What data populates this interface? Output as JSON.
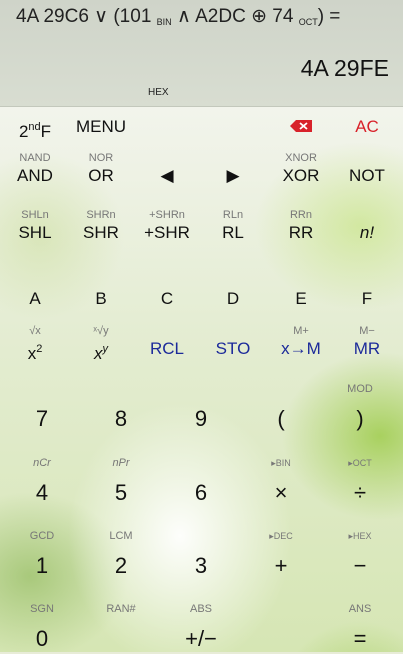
{
  "display": {
    "expr_part1": "4A 29C6 ∨ (101 ",
    "expr_sub1": "BIN",
    "expr_part2": " ∧ A2DC ⊕ 74 ",
    "expr_sub2": "OCT",
    "expr_part3": ") =",
    "result": "4A 29FE",
    "mode": "HEX"
  },
  "colors": {
    "accent_red": "#d8222a",
    "memory_blue": "#1c2a9a"
  },
  "keys": {
    "second": {
      "main": "2",
      "sup": "nd",
      "tail": "F"
    },
    "menu": {
      "main": "MENU"
    },
    "backspace": {
      "icon": "backspace-icon"
    },
    "ac": {
      "main": "AC"
    },
    "and": {
      "sec": "NAND",
      "main": "AND"
    },
    "or": {
      "sec": "NOR",
      "main": "OR"
    },
    "left": {
      "main": "◀"
    },
    "right": {
      "main": "▶"
    },
    "xor": {
      "sec": "XNOR",
      "main": "XOR"
    },
    "not": {
      "main": "NOT"
    },
    "shl": {
      "sec": "SHLn",
      "main": "SHL"
    },
    "shr": {
      "sec": "SHRn",
      "main": "SHR"
    },
    "pshr": {
      "sec": "+SHRn",
      "main": "+SHR"
    },
    "rl": {
      "sec": "RLn",
      "main": "RL"
    },
    "rr": {
      "sec": "RRn",
      "main": "RR"
    },
    "fact": {
      "main": "n!"
    },
    "a": {
      "main": "A"
    },
    "b": {
      "main": "B"
    },
    "c": {
      "main": "C"
    },
    "d": {
      "main": "D"
    },
    "e": {
      "main": "E"
    },
    "f": {
      "main": "F"
    },
    "sq": {
      "sec": "√x",
      "main": "x",
      "sup": "2"
    },
    "pow": {
      "sec": "ˣ√y",
      "main": "x",
      "sup": "y"
    },
    "rcl": {
      "main": "RCL"
    },
    "sto": {
      "main": "STO"
    },
    "xtom": {
      "sec": "M+",
      "main": "x→M"
    },
    "mr": {
      "sec": "M−",
      "main": "MR"
    },
    "k7": {
      "main": "7"
    },
    "k8": {
      "main": "8"
    },
    "k9": {
      "main": "9"
    },
    "lparen": {
      "main": "("
    },
    "rparen": {
      "sec": "MOD",
      "main": ")"
    },
    "k4": {
      "sec": "nCr",
      "main": "4"
    },
    "k5": {
      "sec": "nPr",
      "main": "5"
    },
    "k6": {
      "main": "6"
    },
    "mul": {
      "sec": "▸BIN",
      "main": "×"
    },
    "div": {
      "sec": "▸OCT",
      "main": "÷"
    },
    "k1": {
      "sec": "GCD",
      "main": "1"
    },
    "k2": {
      "sec": "LCM",
      "main": "2"
    },
    "k3": {
      "main": "3"
    },
    "add": {
      "sec": "▸DEC",
      "main": "+"
    },
    "sub": {
      "sec": "▸HEX",
      "main": "−"
    },
    "k0": {
      "sec": "SGN",
      "main": "0"
    },
    "ran": {
      "sec": "RAN#"
    },
    "neg": {
      "sec": "ABS",
      "main": "+/−"
    },
    "eq": {
      "sec": "ANS",
      "main": "="
    }
  }
}
